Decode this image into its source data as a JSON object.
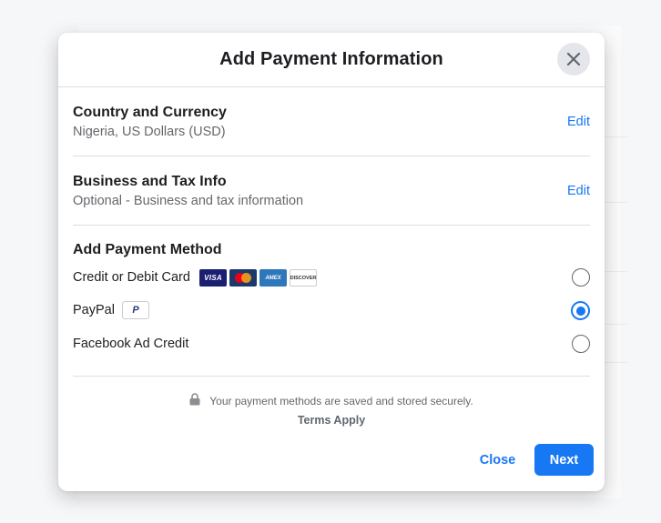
{
  "modal": {
    "title": "Add Payment Information",
    "close_icon": "close-x-icon"
  },
  "country": {
    "title": "Country and Currency",
    "value": "Nigeria, US Dollars (USD)",
    "edit_label": "Edit"
  },
  "business": {
    "title": "Business and Tax Info",
    "value": "Optional - Business and tax information",
    "edit_label": "Edit"
  },
  "payment_method": {
    "title": "Add Payment Method",
    "options": [
      {
        "label": "Credit or Debit Card",
        "selected": false,
        "badges": [
          "VISA",
          "mastercard",
          "AMEX",
          "DISCOVER"
        ]
      },
      {
        "label": "PayPal",
        "selected": true,
        "badge": "P"
      },
      {
        "label": "Facebook Ad Credit",
        "selected": false
      }
    ]
  },
  "footer": {
    "secure_text": "Your payment methods are saved and stored securely.",
    "terms_label": "Terms Apply",
    "close_label": "Close",
    "next_label": "Next"
  },
  "colors": {
    "accent": "#1877f2",
    "text": "#1c1e21",
    "secondary": "#65676b"
  }
}
